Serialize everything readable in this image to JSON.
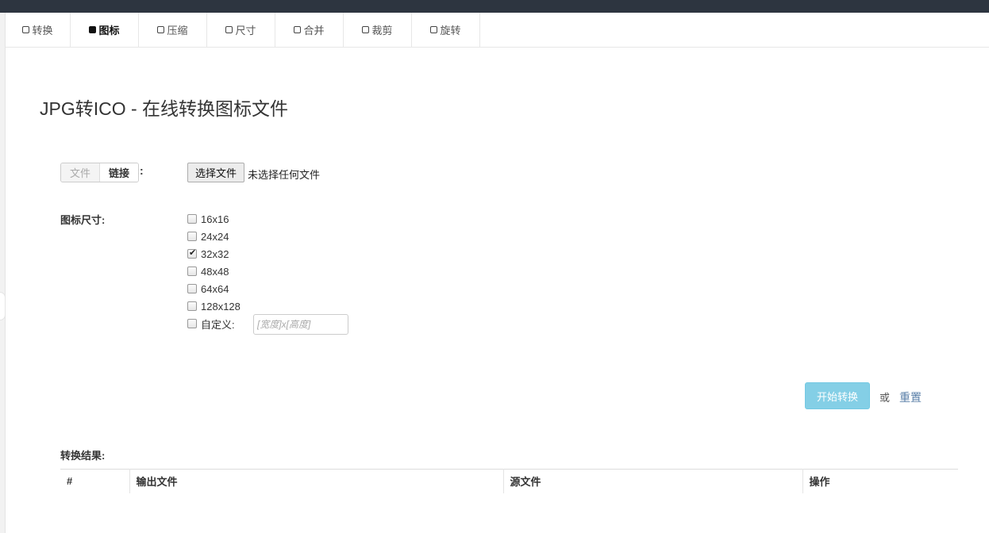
{
  "tabs": [
    {
      "label": "转换",
      "active": false
    },
    {
      "label": "图标",
      "active": true
    },
    {
      "label": "压缩",
      "active": false
    },
    {
      "label": "尺寸",
      "active": false
    },
    {
      "label": "合并",
      "active": false
    },
    {
      "label": "裁剪",
      "active": false
    },
    {
      "label": "旋转",
      "active": false
    }
  ],
  "page_title": "JPG转ICO - 在线转换图标文件",
  "source": {
    "mode_file": "文件",
    "mode_link": "链接",
    "colon": ":",
    "choose_button": "选择文件",
    "file_status": "未选择任何文件"
  },
  "icon_size": {
    "label": "图标尺寸:",
    "options": [
      {
        "label": "16x16",
        "checked": false
      },
      {
        "label": "24x24",
        "checked": false
      },
      {
        "label": "32x32",
        "checked": true
      },
      {
        "label": "48x48",
        "checked": false
      },
      {
        "label": "64x64",
        "checked": false
      },
      {
        "label": "128x128",
        "checked": false
      },
      {
        "label": "自定义:",
        "checked": false
      }
    ],
    "custom_placeholder": "[宽度]x[高度]"
  },
  "actions": {
    "start_label": "开始转换",
    "or_label": "或",
    "reset_label": "重置"
  },
  "results": {
    "label": "转换结果:",
    "columns": [
      "#",
      "输出文件",
      "源文件",
      "操作"
    ]
  },
  "colors": {
    "topbar": "#2d3540",
    "start_button": "#5bc0de",
    "link": "#5a7fa8"
  }
}
